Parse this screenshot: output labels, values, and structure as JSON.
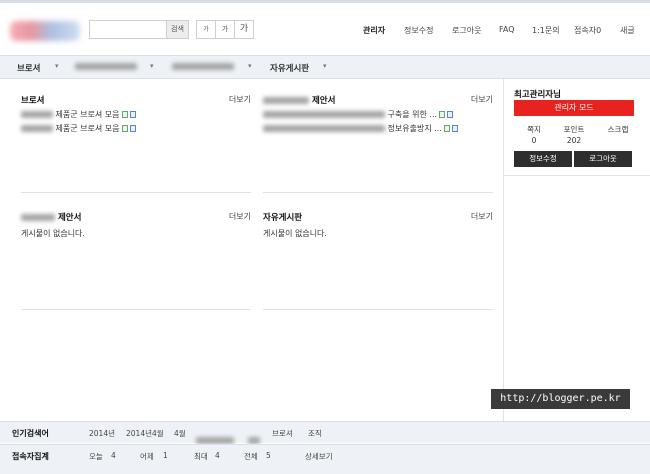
{
  "header": {
    "search": {
      "value": "",
      "placeholder": "",
      "button_label": "검색"
    },
    "font_sizes": [
      "가",
      "가",
      "가"
    ],
    "nav": [
      "관리자",
      "정보수정",
      "로그아웃",
      "FAQ",
      "1:1문의",
      "접속자0",
      "새글"
    ]
  },
  "menu": {
    "items": [
      "브로셔",
      "",
      "",
      "자유게시판"
    ]
  },
  "panels": [
    {
      "title": "브로셔",
      "title_blurred": false,
      "more": "더보기",
      "posts": [
        "제품군 브로셔 모음",
        "제품군 브로셔 모음"
      ]
    },
    {
      "title": "제안서",
      "title_blurred": true,
      "more": "더보기",
      "posts": [
        "구축을 위한 ...",
        "정보유출방지 ..."
      ]
    },
    {
      "title": "제안서",
      "title_blurred": true,
      "more": "더보기",
      "posts": [
        "게시물이 없습니다."
      ]
    },
    {
      "title": "자유게시판",
      "title_blurred": false,
      "more": "더보기",
      "posts": [
        "게시물이 없습니다."
      ]
    }
  ],
  "sidebar": {
    "title": "최고관리자님",
    "admin_mode_button": "관리자 모드",
    "stats": [
      {
        "label": "쪽지",
        "value": "0"
      },
      {
        "label": "포인트",
        "value": "202"
      },
      {
        "label": "스크랩",
        "value": ""
      }
    ],
    "edit_button": "정보수정",
    "logout_button": "로그아웃"
  },
  "watermark": "http://blogger.pe.kr",
  "footer": {
    "popular": {
      "label": "인기검색어",
      "terms": [
        "2014년",
        "2014년4월",
        "4월",
        "",
        "",
        "브로셔",
        "조직"
      ]
    },
    "visitors": {
      "label": "접속자집계",
      "today_label": "오늘",
      "today": "4",
      "yesterday_label": "어제",
      "yesterday": "1",
      "max_label": "최대",
      "max": "4",
      "total_label": "전체",
      "total": "5",
      "detail_link": "상세보기"
    }
  },
  "colors": {
    "accent_red": "#e8231f",
    "menu_bg": "#eef2f6",
    "dark_button": "#2e2e2e"
  }
}
